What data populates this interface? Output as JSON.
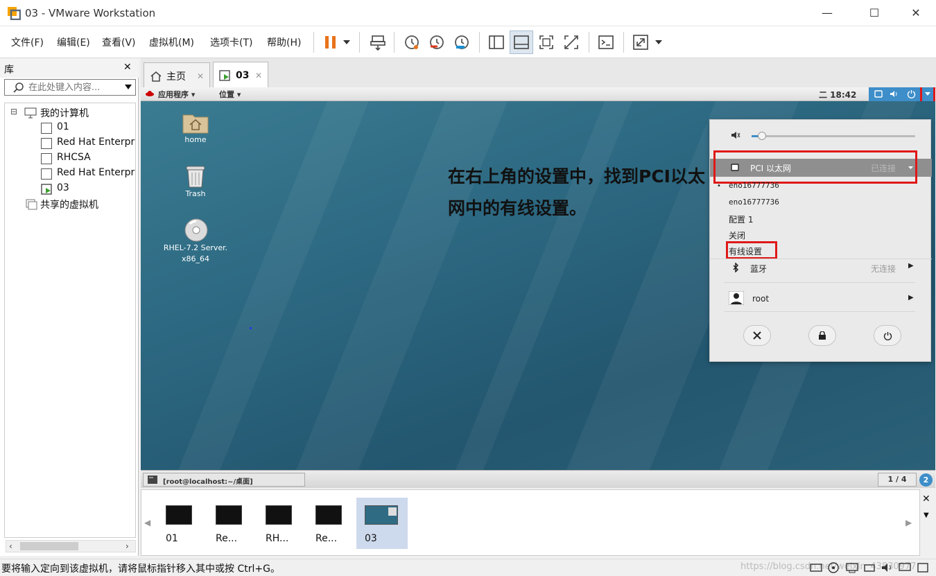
{
  "window": {
    "title": "03 - VMware Workstation",
    "minimize": "—",
    "maximize": "☐",
    "close": "✕"
  },
  "menu": [
    "文件(F)",
    "编辑(E)",
    "查看(V)",
    "虚拟机(M)",
    "选项卡(T)",
    "帮助(H)"
  ],
  "library": {
    "title": "库",
    "close": "✕",
    "search_placeholder": "在此处键入内容...",
    "root": "我的计算机",
    "vms": [
      "01",
      "Red Hat Enterpr",
      "RHCSA",
      "Red Hat Enterpr",
      "03"
    ],
    "shared": "共享的虚拟机",
    "expander": "⊟"
  },
  "tabs": [
    {
      "label": "主页",
      "close": "✕"
    },
    {
      "label": "03",
      "close": "✕"
    }
  ],
  "guest": {
    "apps_menu": "应用程序 ▾",
    "places_menu": "位置 ▾",
    "clock": "二 18:42",
    "desktop_icons": [
      {
        "label": "home"
      },
      {
        "label": "Trash"
      },
      {
        "label": "RHEL-7.2 Server.",
        "label2": "x86_64"
      }
    ],
    "overlay_text": "在右上角的设置中，找到PCI以太网中的有线设置。",
    "panel": {
      "ethernet_label": "PCI 以太网",
      "ethernet_status": "已连接",
      "iface_1": "eno16777736",
      "iface_2": "eno16777736",
      "profile": "配置 1",
      "off": "关闭",
      "wired_settings": "有线设置",
      "bluetooth_label": "蓝牙",
      "bluetooth_status": "无连接",
      "user": "root"
    },
    "taskbar_item": "[root@localhost:~/桌面]",
    "workspace": "1 / 4",
    "badge": "2"
  },
  "thumbnails": [
    "01",
    "Re...",
    "RH...",
    "Re...",
    "03"
  ],
  "status_text": "要将输入定向到该虚拟机，请将鼠标指针移入其中或按 Ctrl+G。",
  "watermark": "https://blog.csdn.net/weixin_43830977"
}
